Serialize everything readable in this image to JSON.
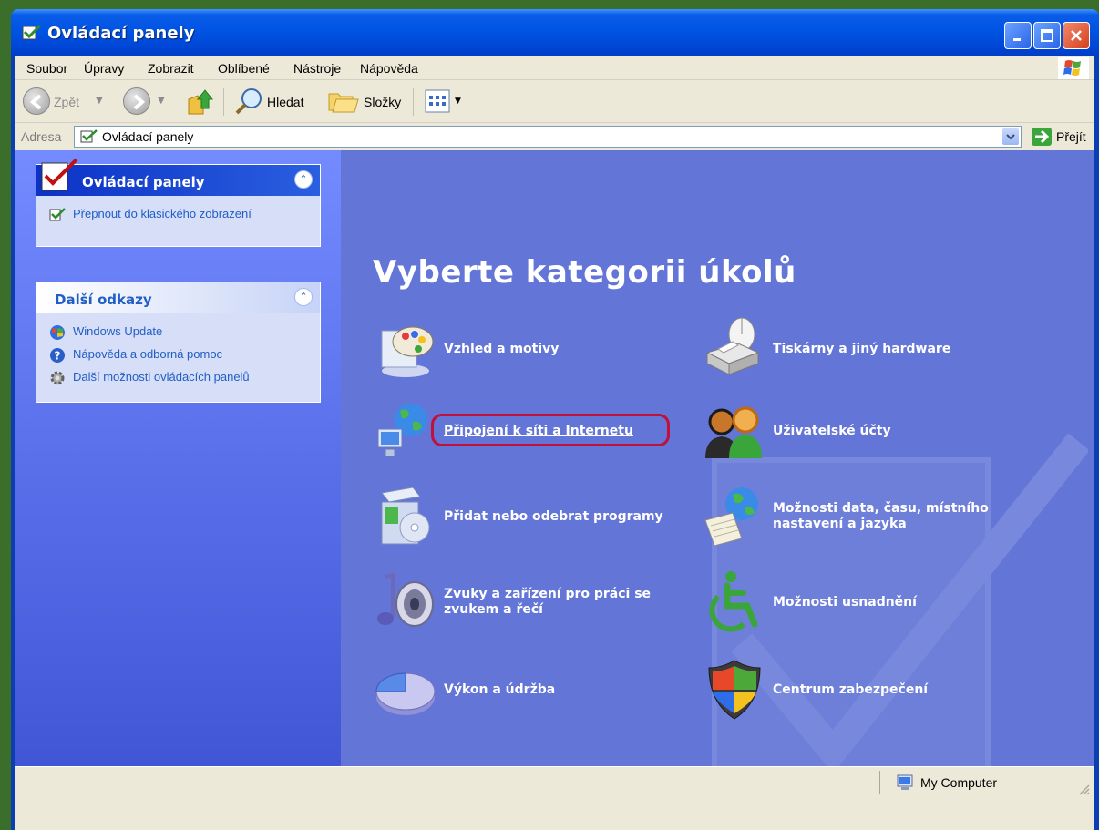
{
  "window": {
    "title": "Ovládací panely"
  },
  "menubar": {
    "items": [
      "Soubor",
      "Úpravy",
      "Zobrazit",
      "Oblíbené",
      "Nástroje",
      "Nápověda"
    ]
  },
  "toolbar": {
    "back_label": "Zpět",
    "search_label": "Hledat",
    "folders_label": "Složky"
  },
  "addressbar": {
    "label": "Adresa",
    "value": "Ovládací panely",
    "go_label": "Přejít"
  },
  "sidebar": {
    "panel_box": {
      "title": "Ovládací panely",
      "link": "Přepnout do klasického zobrazení"
    },
    "links_box": {
      "title": "Další odkazy",
      "items": [
        "Windows Update",
        "Nápověda a odborná pomoc",
        "Další možnosti ovládacích panelů"
      ]
    }
  },
  "main": {
    "heading": "Vyberte kategorii úkolů",
    "categories": [
      "Vzhled a motivy",
      "Tiskárny a jiný hardware",
      "Připojení k síti a Internetu",
      "Uživatelské účty",
      "Přidat nebo odebrat programy",
      "Možnosti data, času, místního nastavení a jazyka",
      "Zvuky a zařízení pro práci se zvukem a řečí",
      "Možnosti usnadnění",
      "Výkon a údržba",
      "Centrum zabezpečení"
    ]
  },
  "statusbar": {
    "zone": "My Computer"
  },
  "colors": {
    "title_blue": "#0054e3",
    "pane_blue": "#6375d6",
    "link_blue": "#215dc6",
    "highlight": "#c0103c"
  }
}
